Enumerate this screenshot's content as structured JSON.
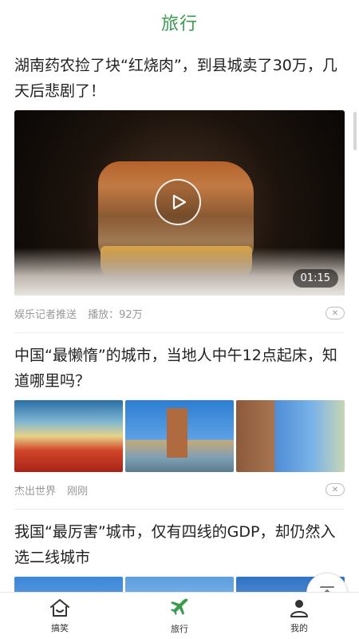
{
  "header": {
    "title": "旅行"
  },
  "articles": [
    {
      "title": "湖南药农捡了块“红烧肉”，到县城卖了30万，几天后悲剧了！",
      "duration": "01:15",
      "source": "娱乐记者推送",
      "stat": "播放：92万"
    },
    {
      "title": "中国“最懒惰”的城市，当地人中午12点起床，知道哪里吗？",
      "source": "杰出世界",
      "time": "刚刚"
    },
    {
      "title": "我国“最厉害”城市，仅有四线的GDP，却仍然入选二线城市"
    }
  ],
  "tabbar": {
    "items": [
      {
        "label": "搞笑",
        "icon": "home-icon"
      },
      {
        "label": "旅行",
        "icon": "airplane-icon",
        "active": true
      },
      {
        "label": "我的",
        "icon": "user-icon"
      }
    ]
  },
  "colors": {
    "accent": "#3a9b4f",
    "meta": "#999999"
  }
}
